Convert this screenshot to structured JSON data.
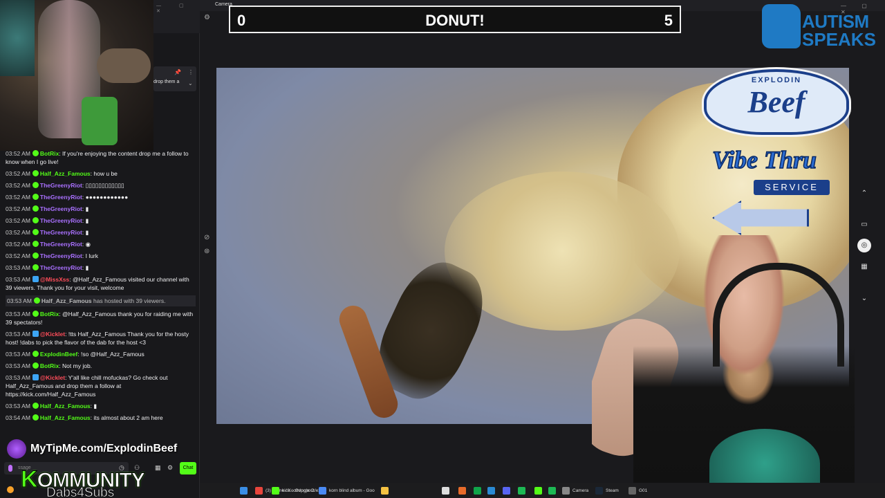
{
  "window": {
    "camera_tab_title": "Camera",
    "pinned_text": "drop them a"
  },
  "scoreboard": {
    "left_score": "0",
    "title": "DONUT!",
    "right_score": "5"
  },
  "overlay": {
    "autism_speaks_line1": "AUTISM",
    "autism_speaks_line2": "SPEAKS",
    "beef_explodin": "EXPLODIN",
    "beef_title": "Beef",
    "vibe_thru": "Vibe Thru",
    "service": "SERVICE",
    "tipme": "MyTipMe.com/ExplodinBeef",
    "kommunity": "OMMUNITY",
    "kommunity_k": "K",
    "dabs4subs": "Dabs4Subs"
  },
  "chat": {
    "messages": [
      {
        "time": "03:52 AM",
        "user": "BotRix",
        "color": "#53fc18",
        "text": "If you're enjoying the content drop me a follow to know when I go live!"
      },
      {
        "time": "03:52 AM",
        "user": "Half_Azz_Famous",
        "color": "#53fc18",
        "text": "how u be"
      },
      {
        "time": "03:52 AM",
        "user": "TheGreenyRiot",
        "color": "#a970ff",
        "text": "▯▯▯▯▯▯▯▯▯▯▯▯"
      },
      {
        "time": "03:52 AM",
        "user": "TheGreenyRiot",
        "color": "#a970ff",
        "text": "●●●●●●●●●●●●"
      },
      {
        "time": "03:52 AM",
        "user": "TheGreenyRiot",
        "color": "#a970ff",
        "text": "▮"
      },
      {
        "time": "03:52 AM",
        "user": "TheGreenyRiot",
        "color": "#a970ff",
        "text": "▮"
      },
      {
        "time": "03:52 AM",
        "user": "TheGreenyRiot",
        "color": "#a970ff",
        "text": "▮"
      },
      {
        "time": "03:52 AM",
        "user": "TheGreenyRiot",
        "color": "#a970ff",
        "text": "◉"
      },
      {
        "time": "03:52 AM",
        "user": "TheGreenyRiot",
        "color": "#a970ff",
        "text": "I lurk"
      },
      {
        "time": "03:53 AM",
        "user": "TheGreenyRiot",
        "color": "#a970ff",
        "text": "▮"
      },
      {
        "time": "03:53 AM",
        "user": "@MissXss",
        "color": "#ff4d5a",
        "text": "@Half_Azz_Famous visited our channel with 39 viewers. Thank you for your visit, welcome"
      },
      {
        "time": "03:53 AM",
        "user": "Half_Azz_Famous",
        "color": "#bbb",
        "text": "has hosted with 39 viewers.",
        "host": true
      },
      {
        "time": "03:53 AM",
        "user": "BotRix",
        "color": "#53fc18",
        "text": "@Half_Azz_Famous thank you for raiding me with 39 spectators!"
      },
      {
        "time": "03:53 AM",
        "user": "@Kicklet",
        "color": "#ff4d5a",
        "text": "!tts Half_Azz_Famous Thank you for the hosty host! !dabs to pick the flavor of the dab for the host <3"
      },
      {
        "time": "03:53 AM",
        "user": "ExplodinBeef",
        "color": "#53fc18",
        "text": "!so @Half_Azz_Famous"
      },
      {
        "time": "03:53 AM",
        "user": "BotRix",
        "color": "#53fc18",
        "text": "Not my job."
      },
      {
        "time": "03:53 AM",
        "user": "@Kicklet",
        "color": "#ff4d5a",
        "text": "Y'all like chill mofuckas? Go check out Half_Azz_Famous and drop them a follow at https://kick.com/Half_Azz_Famous"
      },
      {
        "time": "03:53 AM",
        "user": "Half_Azz_Famous",
        "color": "#53fc18",
        "text": "▮"
      },
      {
        "time": "03:54 AM",
        "user": "Half_Azz_Famous",
        "color": "#53fc18",
        "text": "its almost about 2 am here"
      }
    ],
    "input_placeholder": "ssage",
    "chat_button": "Chat"
  },
  "taskbar": {
    "items": [
      {
        "label": "(3) Home / X - Google C",
        "color": "#e8453c"
      },
      {
        "label": "kick.com/popout/explo",
        "color": "#53fc18"
      },
      {
        "label": "korn blind album - Goo",
        "color": "#4a8af4"
      },
      {
        "label": "",
        "color": "#f5c242"
      },
      {
        "label": "",
        "color": "#ddd"
      },
      {
        "label": "",
        "color": "#e86b2a"
      },
      {
        "label": "",
        "color": "#10a54a"
      },
      {
        "label": "",
        "color": "#2a8ad4"
      },
      {
        "label": "",
        "color": "#5865f2"
      },
      {
        "label": "",
        "color": "#1db954"
      },
      {
        "label": "",
        "color": "#53fc18"
      },
      {
        "label": "",
        "color": "#1db954"
      },
      {
        "label": "Camera",
        "color": "#888"
      },
      {
        "label": "Steam",
        "color": "#1b2838"
      },
      {
        "label": "G01",
        "color": "#666"
      }
    ]
  },
  "colors": {
    "kick_green": "#53fc18",
    "autism_blue": "#1f7ac4",
    "beef_navy": "#1b3f8a"
  }
}
